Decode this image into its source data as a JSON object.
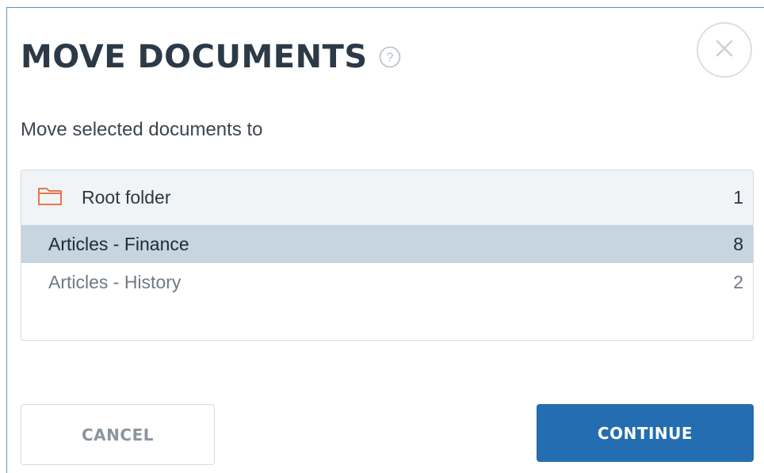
{
  "dialog": {
    "title": "MOVE DOCUMENTS",
    "help_icon": "question-circle-icon",
    "close_icon": "close-circle-icon",
    "subtitle": "Move selected documents to"
  },
  "folders": {
    "root": {
      "label": "Root folder",
      "count": "1",
      "icon": "folder-icon"
    },
    "items": [
      {
        "label": "Articles - Finance",
        "count": "8",
        "selected": true
      },
      {
        "label": "Articles - History",
        "count": "2",
        "selected": false
      }
    ]
  },
  "buttons": {
    "cancel_label": "CANCEL",
    "continue_label": "CONTINUE"
  },
  "colors": {
    "accent": "#246db0",
    "selected_row": "#c6d5e0",
    "folder_icon": "#e8764a"
  }
}
